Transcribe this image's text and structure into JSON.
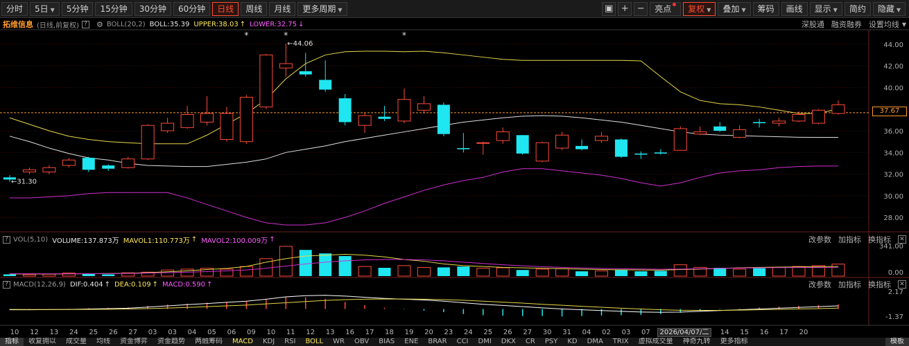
{
  "toolbar": {
    "periods": [
      {
        "label": "分时",
        "active": false,
        "caret": false
      },
      {
        "label": "5日",
        "active": false,
        "caret": true
      },
      {
        "label": "5分钟",
        "active": false,
        "caret": false
      },
      {
        "label": "15分钟",
        "active": false,
        "caret": false
      },
      {
        "label": "30分钟",
        "active": false,
        "caret": false
      },
      {
        "label": "60分钟",
        "active": false,
        "caret": false
      },
      {
        "label": "日线",
        "active": true,
        "caret": false
      },
      {
        "label": "周线",
        "active": false,
        "caret": false
      },
      {
        "label": "月线",
        "active": false,
        "caret": false
      },
      {
        "label": "更多周期",
        "active": false,
        "caret": true
      }
    ],
    "icons": [
      "▣",
      "+",
      "−"
    ],
    "right_buttons": [
      {
        "label": "亮点",
        "active": false,
        "dot": true
      },
      {
        "label": "复权",
        "active": true,
        "caret": true
      },
      {
        "label": "叠加",
        "active": false,
        "caret": true
      },
      {
        "label": "筹码",
        "active": false
      },
      {
        "label": "画线",
        "active": false
      },
      {
        "label": "显示",
        "active": false,
        "caret": true
      },
      {
        "label": "简约",
        "active": false
      },
      {
        "label": "隐藏",
        "active": false,
        "caret": true
      }
    ]
  },
  "main_info": {
    "stock_name": "拓维信息",
    "period_desc": "(日线,前复权)",
    "indicator": "BOLL(20,2)",
    "boll": "BOLL:35.39",
    "upper": "UPPER:38.03",
    "lower": "LOWER:32.75",
    "links": [
      "深股通",
      "融资融券",
      "设置均线"
    ]
  },
  "vol_info": {
    "indicator": "VOL(5,10)",
    "volume": "VOLUME:137.873万",
    "mavol1": "MAVOL1:110.773万",
    "mavol2": "MAVOL2:100.009万",
    "links": [
      "改参数",
      "加指标",
      "换指标"
    ]
  },
  "macd_info": {
    "indicator": "MACD(12,26,9)",
    "dif": "DIF:0.404",
    "dea": "DEA:0.109",
    "macd": "MACD:0.590",
    "links": [
      "改参数",
      "加指标",
      "换指标"
    ]
  },
  "date_tip": "2026/04/07/二",
  "last_price_tag": "37.67",
  "bottom_tabs": [
    "指标",
    "收复拥以",
    "成交量",
    "均线",
    "资金博弈",
    "资金趋势",
    "两融筹码",
    "MACD",
    "KDJ",
    "RSI",
    "BOLL",
    "WR",
    "OBV",
    "BIAS",
    "ENE",
    "BRAR",
    "CCI",
    "DMI",
    "DKX",
    "CR",
    "PSY",
    "KD",
    "DMA",
    "TRIX",
    "虚拟成交量",
    "神奇九转",
    "更多指标",
    "模板"
  ],
  "bottom_highlighted": [
    "MACD",
    "BOLL"
  ],
  "colors": {
    "up": "#ff4a3a",
    "down": "#1fe6f0",
    "boll_mid": "#e0e0e0",
    "upper": "#e8d84a",
    "lower": "#d02fd0",
    "last_price": "#ff9a2e"
  },
  "chart_data": {
    "type": "candlestick",
    "x_tick_labels": [
      "10",
      "12",
      "13",
      "24",
      "25",
      "26",
      "27",
      "03",
      "03",
      "04",
      "05",
      "06",
      "09",
      "10",
      "11",
      "12",
      "13",
      "16",
      "17",
      "18",
      "19",
      "20",
      "23",
      "24",
      "25",
      "26",
      "27",
      "30",
      "31",
      "04",
      "02",
      "03",
      "07",
      "08",
      "10",
      "13",
      "14",
      "15",
      "16",
      "17",
      "20"
    ],
    "price_axis": {
      "ylim": [
        26.8,
        45.2
      ],
      "ticks": [
        28.0,
        30.0,
        32.0,
        34.0,
        36.0,
        38.0,
        40.0,
        42.0,
        44.0
      ]
    },
    "last_price": 37.67,
    "annotations": [
      {
        "text": "44.06",
        "idx": 14
      },
      {
        "text": "31.30",
        "idx": 0
      }
    ],
    "star_marks_idx": [
      12,
      14,
      20
    ],
    "candles": [
      [
        31.7,
        31.5,
        31.9,
        31.3
      ],
      [
        32.2,
        32.4,
        32.6,
        32.0
      ],
      [
        32.2,
        32.6,
        32.8,
        32.0
      ],
      [
        32.8,
        33.3,
        33.5,
        32.6
      ],
      [
        33.5,
        32.4,
        33.6,
        32.2
      ],
      [
        32.8,
        32.5,
        32.9,
        32.3
      ],
      [
        32.6,
        33.4,
        33.6,
        32.5
      ],
      [
        33.4,
        36.5,
        36.6,
        33.3
      ],
      [
        36.0,
        36.7,
        37.2,
        35.8
      ],
      [
        36.3,
        37.5,
        38.3,
        36.2
      ],
      [
        36.8,
        37.6,
        39.2,
        36.5
      ],
      [
        35.2,
        37.6,
        38.2,
        35.0
      ],
      [
        35.0,
        39.1,
        39.3,
        34.8
      ],
      [
        38.2,
        43.0,
        43.1,
        38.0
      ],
      [
        41.8,
        42.2,
        44.06,
        41.0
      ],
      [
        41.5,
        41.2,
        43.2,
        41.0
      ],
      [
        40.7,
        39.8,
        42.5,
        39.6
      ],
      [
        39.0,
        36.8,
        39.4,
        36.5
      ],
      [
        36.5,
        37.4,
        37.7,
        35.8
      ],
      [
        37.3,
        37.1,
        38.3,
        36.9
      ],
      [
        36.9,
        38.9,
        39.9,
        36.7
      ],
      [
        37.9,
        38.5,
        39.2,
        37.6
      ],
      [
        38.4,
        35.7,
        38.6,
        35.5
      ],
      [
        34.4,
        34.3,
        35.8,
        34.0
      ],
      [
        34.9,
        34.9,
        35.0,
        33.8
      ],
      [
        35.1,
        35.9,
        36.3,
        34.8
      ],
      [
        35.6,
        33.9,
        35.6,
        33.8
      ],
      [
        33.2,
        34.9,
        35.0,
        33.1
      ],
      [
        34.4,
        35.6,
        35.9,
        34.2
      ],
      [
        34.6,
        34.3,
        35.2,
        34.2
      ],
      [
        35.1,
        35.5,
        35.9,
        34.9
      ],
      [
        35.2,
        33.6,
        35.3,
        33.5
      ],
      [
        33.9,
        33.8,
        34.1,
        33.4
      ],
      [
        34.0,
        33.9,
        34.3,
        33.8
      ],
      [
        34.2,
        36.2,
        36.4,
        34.2
      ],
      [
        35.7,
        35.9,
        36.4,
        35.6
      ],
      [
        36.4,
        36.0,
        36.8,
        35.9
      ],
      [
        35.4,
        36.1,
        36.5,
        35.3
      ],
      [
        36.8,
        36.7,
        37.1,
        36.3
      ],
      [
        36.7,
        36.9,
        37.2,
        36.4
      ],
      [
        36.9,
        37.5,
        37.8,
        36.8
      ],
      [
        36.7,
        37.9,
        38.0,
        36.6
      ],
      [
        37.6,
        38.4,
        38.8,
        37.5
      ]
    ],
    "boll_mid": [
      35.5,
      35.0,
      34.4,
      33.9,
      33.5,
      33.3,
      33.0,
      32.8,
      32.75,
      32.7,
      32.7,
      32.9,
      33.1,
      33.4,
      34.0,
      34.3,
      34.6,
      35.0,
      35.3,
      35.6,
      35.9,
      36.2,
      36.5,
      36.8,
      37.0,
      37.2,
      37.35,
      37.4,
      37.35,
      37.2,
      37.0,
      36.8,
      36.5,
      36.2,
      35.9,
      35.7,
      35.6,
      35.55,
      35.5,
      35.45,
      35.4,
      35.39,
      35.39
    ],
    "upper": [
      37.2,
      36.6,
      36.0,
      35.5,
      35.2,
      35.0,
      34.9,
      34.8,
      34.8,
      34.8,
      35.6,
      36.6,
      37.6,
      38.9,
      40.8,
      42.2,
      43.0,
      43.3,
      43.35,
      43.35,
      43.3,
      43.35,
      43.2,
      43.0,
      42.8,
      42.6,
      42.5,
      42.5,
      42.5,
      42.5,
      42.5,
      42.5,
      42.45,
      41.0,
      39.6,
      38.8,
      38.5,
      38.4,
      38.2,
      37.9,
      37.6,
      37.6,
      38.03
    ],
    "lower": [
      29.8,
      29.8,
      29.9,
      30.0,
      30.2,
      30.3,
      30.3,
      30.3,
      30.3,
      29.8,
      29.2,
      28.6,
      28.0,
      27.5,
      27.3,
      27.3,
      27.5,
      28.0,
      28.6,
      29.3,
      29.9,
      30.5,
      31.0,
      31.4,
      31.7,
      32.2,
      32.5,
      32.5,
      32.3,
      32.1,
      31.9,
      31.6,
      31.2,
      30.9,
      31.2,
      31.7,
      32.1,
      32.3,
      32.4,
      32.6,
      32.7,
      32.75,
      32.75
    ],
    "volume": {
      "ylim": [
        0,
        341
      ],
      "ticks": [
        "341.00",
        "0.00"
      ],
      "bars": [
        20,
        18,
        22,
        35,
        30,
        20,
        38,
        45,
        70,
        80,
        90,
        80,
        110,
        200,
        341,
        300,
        260,
        230,
        110,
        95,
        120,
        100,
        100,
        110,
        90,
        95,
        70,
        80,
        85,
        55,
        60,
        70,
        55,
        60,
        130,
        100,
        95,
        80,
        90,
        100,
        110,
        120,
        137.9
      ],
      "mavol1": [
        25,
        25,
        24,
        26,
        27,
        30,
        33,
        40,
        50,
        60,
        75,
        88,
        110,
        160,
        200,
        230,
        240,
        250,
        240,
        220,
        190,
        170,
        140,
        120,
        110,
        100,
        95,
        90,
        85,
        80,
        75,
        72,
        70,
        68,
        75,
        80,
        88,
        95,
        100,
        103,
        106,
        108,
        110.8
      ],
      "mavol2": [
        28,
        27,
        27,
        27,
        28,
        29,
        31,
        35,
        40,
        45,
        52,
        60,
        70,
        90,
        115,
        140,
        160,
        175,
        185,
        190,
        190,
        185,
        175,
        160,
        145,
        130,
        118,
        108,
        100,
        93,
        88,
        84,
        81,
        78,
        80,
        84,
        88,
        92,
        95,
        97,
        98,
        99,
        100.0
      ]
    },
    "macd": {
      "ylim": [
        -1.37,
        2.17
      ],
      "ticks": [
        "2.17",
        "-1.37"
      ],
      "dif": [
        -0.1,
        -0.1,
        -0.08,
        -0.05,
        0.0,
        0.05,
        0.1,
        0.25,
        0.4,
        0.55,
        0.7,
        0.85,
        1.0,
        1.25,
        1.55,
        1.7,
        1.75,
        1.65,
        1.5,
        1.35,
        1.25,
        1.15,
        1.0,
        0.8,
        0.6,
        0.45,
        0.3,
        0.15,
        0.0,
        -0.1,
        -0.2,
        -0.3,
        -0.38,
        -0.42,
        -0.4,
        -0.3,
        -0.2,
        -0.1,
        0.0,
        0.1,
        0.2,
        0.3,
        0.404
      ],
      "dea": [
        -0.05,
        -0.06,
        -0.07,
        -0.06,
        -0.05,
        -0.03,
        0.0,
        0.05,
        0.12,
        0.2,
        0.3,
        0.4,
        0.5,
        0.65,
        0.8,
        0.95,
        1.1,
        1.2,
        1.25,
        1.27,
        1.27,
        1.25,
        1.2,
        1.12,
        1.0,
        0.88,
        0.75,
        0.6,
        0.48,
        0.35,
        0.22,
        0.1,
        0.0,
        -0.1,
        -0.16,
        -0.18,
        -0.17,
        -0.14,
        -0.1,
        -0.05,
        0.0,
        0.05,
        0.109
      ],
      "hist": [
        -0.1,
        -0.08,
        -0.02,
        0.02,
        0.1,
        0.16,
        0.2,
        0.4,
        0.56,
        0.7,
        0.8,
        0.9,
        1.0,
        1.2,
        1.5,
        1.5,
        1.3,
        0.9,
        0.5,
        0.16,
        -0.04,
        -0.2,
        -0.4,
        -0.64,
        -0.8,
        -0.86,
        -0.9,
        -0.9,
        -0.96,
        -0.9,
        -0.84,
        -0.8,
        -0.76,
        -0.64,
        -0.48,
        -0.24,
        -0.06,
        0.08,
        0.2,
        0.3,
        0.4,
        0.5,
        0.59
      ]
    }
  }
}
